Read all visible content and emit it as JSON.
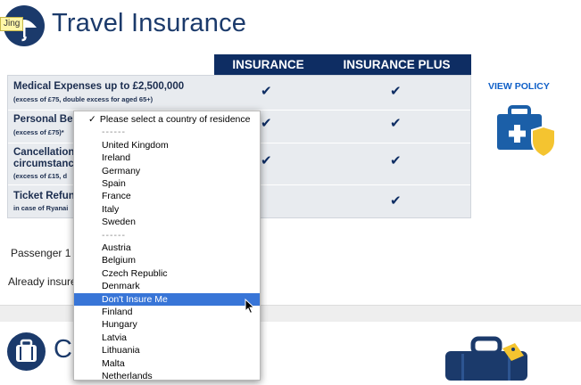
{
  "header": {
    "title": "Travel Insurance",
    "jing_label": "Jing"
  },
  "table": {
    "columns": [
      "INSURANCE",
      "INSURANCE PLUS"
    ],
    "rows": [
      {
        "title": "Medical Expenses up to £2,500,000",
        "sub": "(excess of £75, double excess for aged 65+)",
        "insurance": true,
        "plus": true
      },
      {
        "title": "Personal Be",
        "sub": "(excess of £75)*",
        "insurance": true,
        "plus": true
      },
      {
        "title": "Cancellation",
        "title2": "circumstanc",
        "sub": "(excess of £15, d",
        "insurance": true,
        "plus": true
      },
      {
        "title": "Ticket Refun",
        "sub": "in case of Ryanai",
        "insurance": false,
        "plus": true
      }
    ],
    "tick_glyph": "✔"
  },
  "view_policy": "VIEW POLICY",
  "passenger_label": "Passenger 1",
  "already_text": "Already insure                                                          down box.",
  "bags_title": "Che",
  "dropdown": {
    "items": [
      {
        "label": "Please select a country of residence",
        "checked": true
      },
      {
        "label": "------",
        "sep": true
      },
      {
        "label": "United Kingdom"
      },
      {
        "label": "Ireland"
      },
      {
        "label": "Germany"
      },
      {
        "label": "Spain"
      },
      {
        "label": "France"
      },
      {
        "label": "Italy"
      },
      {
        "label": "Sweden"
      },
      {
        "label": "------",
        "sep": true
      },
      {
        "label": "Austria"
      },
      {
        "label": "Belgium"
      },
      {
        "label": "Czech Republic"
      },
      {
        "label": "Denmark"
      },
      {
        "label": "Don't Insure Me",
        "highlighted": true
      },
      {
        "label": "Finland"
      },
      {
        "label": "Hungary"
      },
      {
        "label": "Latvia"
      },
      {
        "label": "Lithuania"
      },
      {
        "label": "Malta"
      },
      {
        "label": "Netherlands"
      }
    ],
    "check_glyph": "✓"
  },
  "colors": {
    "navy": "#0e2d63",
    "link": "#1060c8",
    "highlight": "#3875d7",
    "shield": "#f4c430"
  }
}
